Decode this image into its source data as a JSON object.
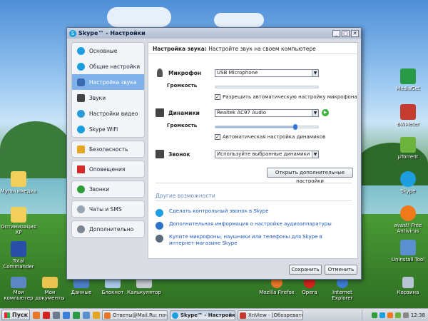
{
  "window": {
    "title": "Skype™ - Настройки",
    "buttons": {
      "minimize": "_",
      "maximize": "□",
      "close": "✕"
    }
  },
  "sidebar": {
    "groups": [
      {
        "items": [
          {
            "label": "Основные",
            "icon": "skype-logo-icon",
            "active": false
          },
          {
            "label": "Общие настройки",
            "icon": "skype-logo-icon",
            "active": false
          },
          {
            "label": "Настройка звука",
            "icon": "microphone-icon",
            "active": true
          },
          {
            "label": "Звуки",
            "icon": "speaker-icon",
            "active": false
          },
          {
            "label": "Настройки видео",
            "icon": "webcam-icon",
            "active": false
          },
          {
            "label": "Skype WiFi",
            "icon": "wifi-icon",
            "active": false
          }
        ]
      },
      {
        "items": [
          {
            "label": "Безопасность",
            "icon": "lock-icon"
          }
        ]
      },
      {
        "items": [
          {
            "label": "Оповещения",
            "icon": "flag-icon"
          }
        ]
      },
      {
        "items": [
          {
            "label": "Звонки",
            "icon": "phone-icon"
          }
        ]
      },
      {
        "items": [
          {
            "label": "Чаты и SMS",
            "icon": "chat-icon"
          }
        ]
      },
      {
        "items": [
          {
            "label": "Дополнительно",
            "icon": "gear-icon"
          }
        ]
      }
    ]
  },
  "panel": {
    "header_title": "Настройка звука:",
    "header_desc": " Настройте звук на своем компьютере",
    "microphone": {
      "label": "Микрофон",
      "device": "USB Microphone",
      "volume_label": "Громкость",
      "volume_level": 0.0,
      "auto_label": "Разрешить автоматическую настройку микрофона",
      "auto_checked": true
    },
    "speakers": {
      "label": "Динамики",
      "device": "Realtek AC97 Audio",
      "volume_label": "Громкость",
      "volume_level": 0.78,
      "auto_label": "Автоматическая настройка динамиков",
      "auto_checked": true
    },
    "ring": {
      "label": "Звонок",
      "device": "Используйте выбранные динамики"
    },
    "advanced_button": "Открыть дополнительные настройки",
    "more_title": "Другие возможности",
    "links": [
      {
        "text": "Сделать контрольный звонок в Skype",
        "icon": "user-icon"
      },
      {
        "text": "Дополнительная информация о настройке аудиоаппаратуры",
        "icon": "info-icon"
      },
      {
        "text": "Купите микрофоны, наушники или телефоны для Skype в интернет-магазине Skype",
        "icon": "headset-icon"
      }
    ]
  },
  "footer": {
    "save": "Сохранить",
    "cancel": "Отменить"
  },
  "desktop": {
    "left_icons": [
      "Мультимедиа",
      "Оптимизация XP",
      "Total Commander"
    ],
    "bottom_icons": [
      "Мои компьютер",
      "Мои документы",
      "Данные",
      "Блокнот",
      "Калькулятор"
    ],
    "right_icons": [
      "MediaGet",
      "BWMeter",
      "µTorrent",
      "Skype",
      "avast! Free Antivirus",
      "Uninstall Tool"
    ],
    "bottom_right_icons": [
      "Mozilla Firefox",
      "Opera",
      "Internet Explorer",
      "Корзина"
    ]
  },
  "taskbar": {
    "start": "Пуск",
    "tasks": [
      {
        "label": "Ответы@Mail.Ru: поче...",
        "active": false
      },
      {
        "label": "Skype™ - Настройки",
        "active": true
      },
      {
        "label": "XnView - [Обозреватель...",
        "active": false
      }
    ],
    "clock": "12:38"
  },
  "colors": {
    "accent": "#7fb2ea",
    "skype": "#1c9ee0",
    "link": "#1a55c0",
    "thumb": "#3477d8"
  }
}
